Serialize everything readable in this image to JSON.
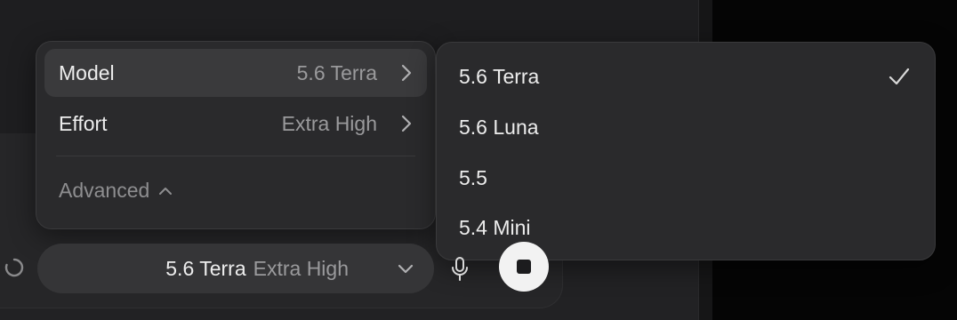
{
  "settings_menu": {
    "rows": [
      {
        "label": "Model",
        "value": "5.6 Terra"
      },
      {
        "label": "Effort",
        "value": "Extra High"
      }
    ],
    "advanced_label": "Advanced"
  },
  "model_menu": {
    "options": [
      {
        "label": "5.6 Terra",
        "checked": true
      },
      {
        "label": "5.6 Luna",
        "checked": false
      },
      {
        "label": "5.5",
        "checked": false
      },
      {
        "label": "5.4 Mini",
        "checked": false
      }
    ]
  },
  "toolbar": {
    "model": "5.6 Terra",
    "effort": "Extra High"
  },
  "icons": {
    "chevron": "chevron-right-icon",
    "check": "checkmark-icon",
    "mic": "microphone-icon",
    "stop": "stop-icon",
    "spinner": "loading-spinner-icon"
  },
  "colors": {
    "menu_bg": "#2a2a2c",
    "selected_row": "#3a3a3c",
    "pill_bg": "#353537",
    "stop_button": "#f2f2f2"
  }
}
